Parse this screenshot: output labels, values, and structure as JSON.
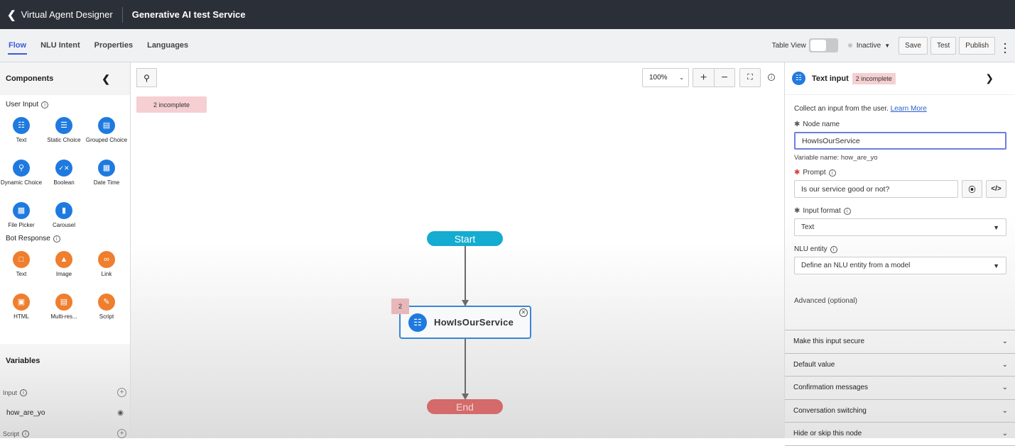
{
  "topbar": {
    "back_label": "Virtual Agent Designer",
    "title": "Generative AI test Service"
  },
  "tabs": [
    {
      "label": "Flow",
      "active": true
    },
    {
      "label": "NLU Intent"
    },
    {
      "label": "Properties"
    },
    {
      "label": "Languages"
    }
  ],
  "actions": {
    "table_view_label": "Table View",
    "table_view_on": false,
    "status": "Inactive",
    "save": "Save",
    "test": "Test",
    "publish": "Publish"
  },
  "components": {
    "title": "Components",
    "user_input_label": "User Input",
    "user_input": [
      {
        "label": "Text",
        "icon": "text-input-icon"
      },
      {
        "label": "Static Choice",
        "icon": "list-icon"
      },
      {
        "label": "Grouped Choice",
        "icon": "grouped-icon"
      },
      {
        "label": "Dynamic Choice",
        "icon": "search-icon"
      },
      {
        "label": "Boolean",
        "icon": "boolean-icon"
      },
      {
        "label": "Date Time",
        "icon": "calendar-icon"
      },
      {
        "label": "File Picker",
        "icon": "file-icon"
      },
      {
        "label": "Carousel",
        "icon": "carousel-icon"
      }
    ],
    "bot_response_label": "Bot Response",
    "bot_response": [
      {
        "label": "Text",
        "icon": "message-icon"
      },
      {
        "label": "Image",
        "icon": "image-icon"
      },
      {
        "label": "Link",
        "icon": "link-icon"
      },
      {
        "label": "HTML",
        "icon": "html-icon"
      },
      {
        "label": "Multi-res...",
        "icon": "multi-response-icon"
      },
      {
        "label": "Script",
        "icon": "script-icon"
      }
    ]
  },
  "variables": {
    "title": "Variables",
    "input_label": "Input",
    "input_items": [
      "how_are_yo"
    ],
    "script_label": "Script"
  },
  "canvas": {
    "incomplete_badge": "2 incomplete",
    "zoom_level": "100%",
    "start_label": "Start",
    "end_label": "End",
    "node_label": "HowIsOurService",
    "node_badge": "2"
  },
  "panel": {
    "title": "Text input",
    "badge": "2 incomplete",
    "description": "Collect an input from the user.",
    "learn_more": "Learn More",
    "node_name_label": "Node name",
    "node_name_value": "HowIsOurService",
    "variable_name_hint": "Variable name: how_are_yo",
    "prompt_label": "Prompt",
    "prompt_value": "Is our service good or not?",
    "input_format_label": "Input format",
    "input_format_value": "Text",
    "nlu_entity_label": "NLU entity",
    "nlu_entity_value": "Define an NLU entity from a model",
    "advanced_label": "Advanced (optional)",
    "sections": [
      "Make this input secure",
      "Default value",
      "Confirmation messages",
      "Conversation switching",
      "Hide or skip this node"
    ]
  }
}
